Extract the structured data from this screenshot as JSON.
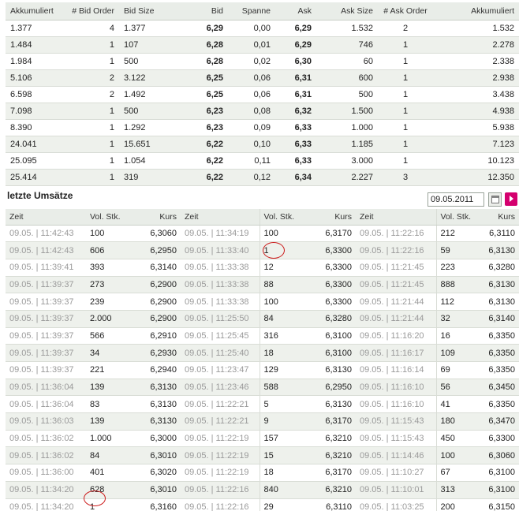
{
  "orderbook": {
    "headers": [
      "Akkumuliert",
      "# Bid Order",
      "Bid Size",
      "Bid",
      "Spanne",
      "Ask",
      "Ask Size",
      "# Ask Order",
      "Akkumuliert"
    ],
    "rows": [
      [
        "1.377",
        "4",
        "1.377",
        "6,29",
        "0,00",
        "6,29",
        "1.532",
        "2",
        "1.532"
      ],
      [
        "1.484",
        "1",
        "107",
        "6,28",
        "0,01",
        "6,29",
        "746",
        "1",
        "2.278"
      ],
      [
        "1.984",
        "1",
        "500",
        "6,28",
        "0,02",
        "6,30",
        "60",
        "1",
        "2.338"
      ],
      [
        "5.106",
        "2",
        "3.122",
        "6,25",
        "0,06",
        "6,31",
        "600",
        "1",
        "2.938"
      ],
      [
        "6.598",
        "2",
        "1.492",
        "6,25",
        "0,06",
        "6,31",
        "500",
        "1",
        "3.438"
      ],
      [
        "7.098",
        "1",
        "500",
        "6,23",
        "0,08",
        "6,32",
        "1.500",
        "1",
        "4.938"
      ],
      [
        "8.390",
        "1",
        "1.292",
        "6,23",
        "0,09",
        "6,33",
        "1.000",
        "1",
        "5.938"
      ],
      [
        "24.041",
        "1",
        "15.651",
        "6,22",
        "0,10",
        "6,33",
        "1.185",
        "1",
        "7.123"
      ],
      [
        "25.095",
        "1",
        "1.054",
        "6,22",
        "0,11",
        "6,33",
        "3.000",
        "1",
        "10.123"
      ],
      [
        "25.414",
        "1",
        "319",
        "6,22",
        "0,12",
        "6,34",
        "2.227",
        "3",
        "12.350"
      ]
    ]
  },
  "trades_section": {
    "title": "letzte Umsätze",
    "date_value": "09.05.2011",
    "calendar_icon": "calendar-icon",
    "next_icon": "arrow-right-icon",
    "accent_color": "#d4006e"
  },
  "trades": {
    "headers": [
      "Zeit",
      "Vol. Stk.",
      "Kurs",
      "Zeit",
      "Vol. Stk.",
      "Kurs",
      "Zeit",
      "Vol. Stk.",
      "Kurs"
    ],
    "rows": [
      [
        "09.05. | 11:42:43",
        "100",
        "6,3060",
        "09.05. | 11:34:19",
        "100",
        "6,3170",
        "09.05. | 11:22:16",
        "212",
        "6,3110"
      ],
      [
        "09.05. | 11:42:43",
        "606",
        "6,2950",
        "09.05. | 11:33:40",
        "1",
        "6,3300",
        "09.05. | 11:22:16",
        "59",
        "6,3130"
      ],
      [
        "09.05. | 11:39:41",
        "393",
        "6,3140",
        "09.05. | 11:33:38",
        "12",
        "6,3300",
        "09.05. | 11:21:45",
        "223",
        "6,3280"
      ],
      [
        "09.05. | 11:39:37",
        "273",
        "6,2900",
        "09.05. | 11:33:38",
        "88",
        "6,3300",
        "09.05. | 11:21:45",
        "888",
        "6,3130"
      ],
      [
        "09.05. | 11:39:37",
        "239",
        "6,2900",
        "09.05. | 11:33:38",
        "100",
        "6,3300",
        "09.05. | 11:21:44",
        "112",
        "6,3130"
      ],
      [
        "09.05. | 11:39:37",
        "2.000",
        "6,2900",
        "09.05. | 11:25:50",
        "84",
        "6,3280",
        "09.05. | 11:21:44",
        "32",
        "6,3140"
      ],
      [
        "09.05. | 11:39:37",
        "566",
        "6,2910",
        "09.05. | 11:25:45",
        "316",
        "6,3100",
        "09.05. | 11:16:20",
        "16",
        "6,3350"
      ],
      [
        "09.05. | 11:39:37",
        "34",
        "6,2930",
        "09.05. | 11:25:40",
        "18",
        "6,3100",
        "09.05. | 11:16:17",
        "109",
        "6,3350"
      ],
      [
        "09.05. | 11:39:37",
        "221",
        "6,2940",
        "09.05. | 11:23:47",
        "129",
        "6,3130",
        "09.05. | 11:16:14",
        "69",
        "6,3350"
      ],
      [
        "09.05. | 11:36:04",
        "139",
        "6,3130",
        "09.05. | 11:23:46",
        "588",
        "6,2950",
        "09.05. | 11:16:10",
        "56",
        "6,3450"
      ],
      [
        "09.05. | 11:36:04",
        "83",
        "6,3130",
        "09.05. | 11:22:21",
        "5",
        "6,3130",
        "09.05. | 11:16:10",
        "41",
        "6,3350"
      ],
      [
        "09.05. | 11:36:03",
        "139",
        "6,3130",
        "09.05. | 11:22:21",
        "9",
        "6,3170",
        "09.05. | 11:15:43",
        "180",
        "6,3470"
      ],
      [
        "09.05. | 11:36:02",
        "1.000",
        "6,3000",
        "09.05. | 11:22:19",
        "157",
        "6,3210",
        "09.05. | 11:15:43",
        "450",
        "6,3300"
      ],
      [
        "09.05. | 11:36:02",
        "84",
        "6,3010",
        "09.05. | 11:22:19",
        "15",
        "6,3210",
        "09.05. | 11:14:46",
        "100",
        "6,3060"
      ],
      [
        "09.05. | 11:36:00",
        "401",
        "6,3020",
        "09.05. | 11:22:19",
        "18",
        "6,3170",
        "09.05. | 11:10:27",
        "67",
        "6,3100"
      ],
      [
        "09.05. | 11:34:20",
        "628",
        "6,3010",
        "09.05. | 11:22:16",
        "840",
        "6,3210",
        "09.05. | 11:10:01",
        "313",
        "6,3100"
      ],
      [
        "09.05. | 11:34:20",
        "1",
        "6,3160",
        "09.05. | 11:22:16",
        "29",
        "6,3110",
        "09.05. | 11:03:25",
        "200",
        "6,3150"
      ]
    ]
  }
}
